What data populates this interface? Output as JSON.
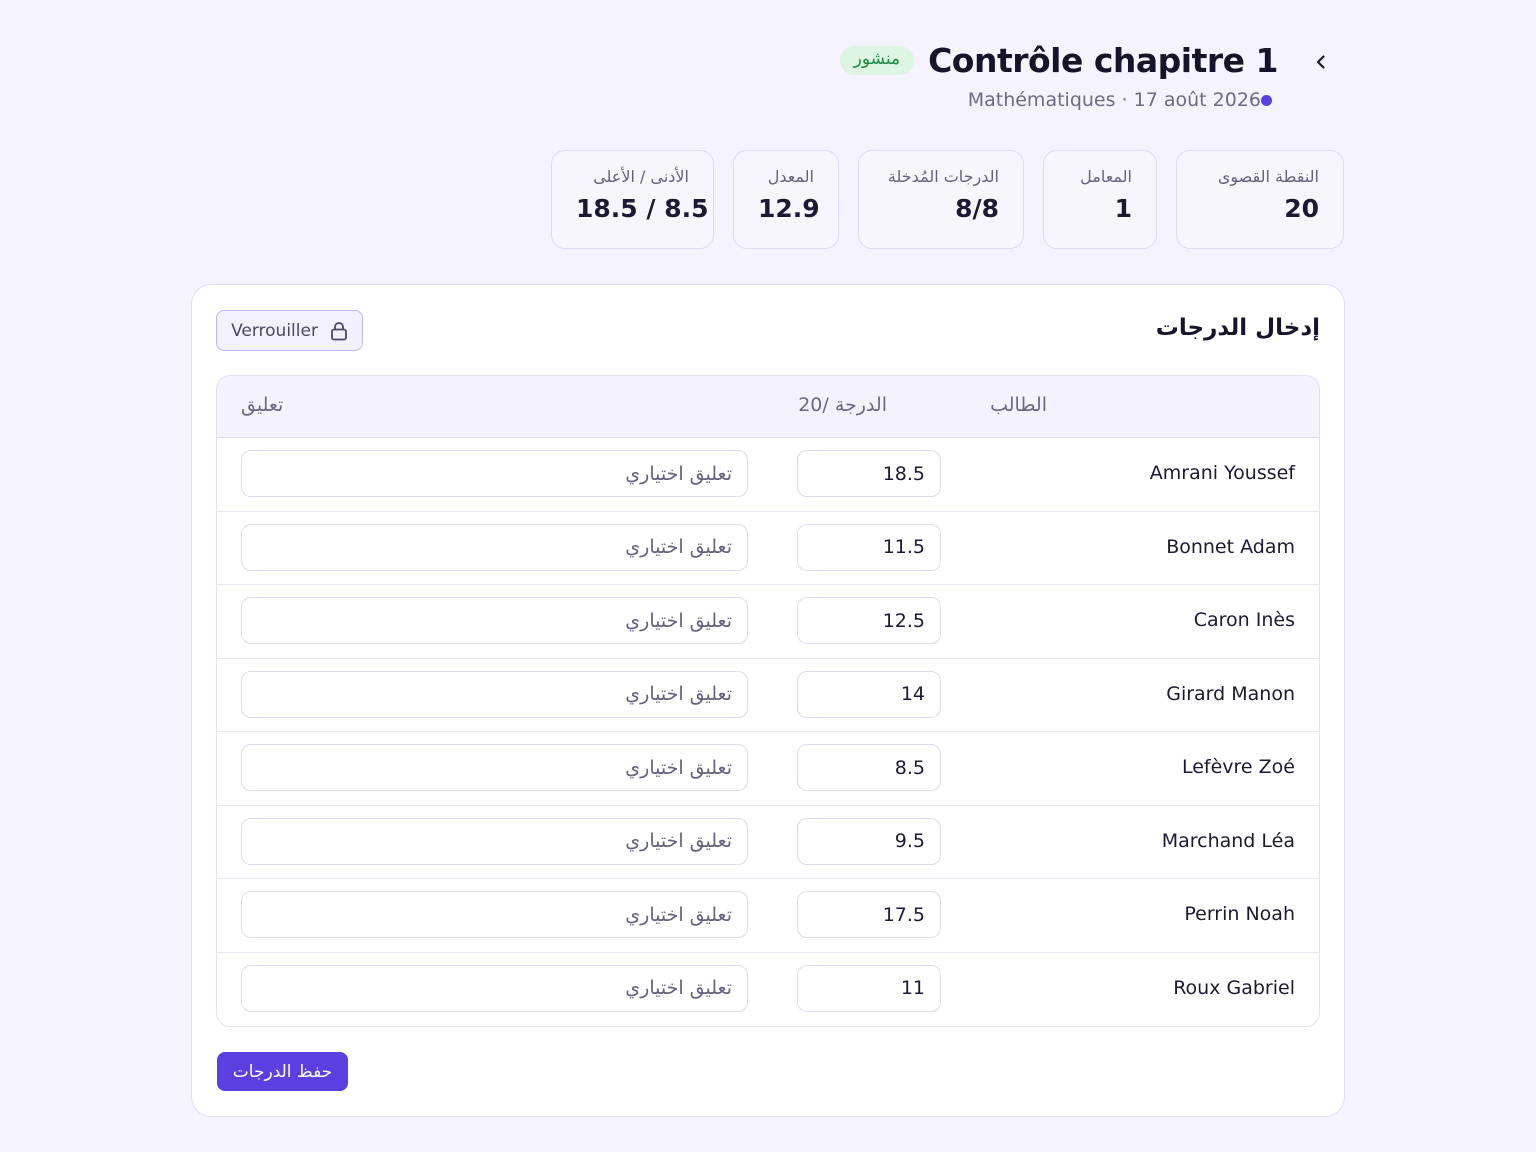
{
  "header": {
    "back_icon": "chevron-left-icon",
    "title": "Contrôle chapitre 1",
    "status_badge": "منشور",
    "subtitle": "Mathématiques · 17 août 2026",
    "accent": "#5b3fe0"
  },
  "stats": [
    {
      "label": "النقطة القصوى",
      "value": "20"
    },
    {
      "label": "المعامل",
      "value": "1"
    },
    {
      "label": "الدرجات المُدخلة",
      "value": "8/8"
    },
    {
      "label": "المعدل",
      "value": "12.9"
    },
    {
      "label": "الأدنى / الأعلى",
      "value": "18.5 / 8.5"
    }
  ],
  "grades_card": {
    "title": "إدخال الدرجات",
    "lock_label": "Verrouiller",
    "lock_icon": "lock-icon",
    "columns": {
      "student": "الطالب",
      "grade": "الدرجة /20",
      "comment": "تعليق"
    },
    "comment_placeholder": "تعليق اختياري",
    "rows": [
      {
        "student": "Amrani Youssef",
        "grade": "18.5"
      },
      {
        "student": "Bonnet Adam",
        "grade": "11.5"
      },
      {
        "student": "Caron Inès",
        "grade": "12.5"
      },
      {
        "student": "Girard Manon",
        "grade": "14"
      },
      {
        "student": "Lefèvre Zoé",
        "grade": "8.5"
      },
      {
        "student": "Marchand Léa",
        "grade": "9.5"
      },
      {
        "student": "Perrin Noah",
        "grade": "17.5"
      },
      {
        "student": "Roux Gabriel",
        "grade": "11"
      }
    ],
    "save_label": "حفظ الدرجات"
  }
}
